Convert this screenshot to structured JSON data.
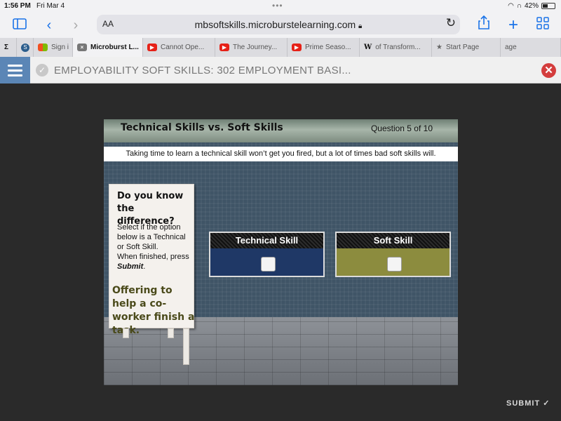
{
  "status_bar": {
    "time": "1:56 PM",
    "date": "Fri Mar 4",
    "battery": "42%",
    "battery_level": 0.42
  },
  "toolbar": {
    "text_size_label": "AA",
    "url": "mbsoftskills.microburstelearning.com",
    "icons": [
      "sidebar-icon",
      "back-icon",
      "forward-icon",
      "lock-icon",
      "reload-icon",
      "share-icon",
      "plus-icon",
      "tabs-grid-icon"
    ]
  },
  "tabs": [
    {
      "label": "",
      "favicon": "sigma"
    },
    {
      "label": "",
      "favicon": "s"
    },
    {
      "label": "Sign i",
      "favicon": "ms"
    },
    {
      "label": "Microburst L...",
      "favicon": "x",
      "active": true
    },
    {
      "label": "Cannot Ope...",
      "favicon": "yt"
    },
    {
      "label": "The Journey...",
      "favicon": "yt"
    },
    {
      "label": "Prime Seaso...",
      "favicon": "yt"
    },
    {
      "label": "of Transform...",
      "favicon": "w"
    },
    {
      "label": "Start Page",
      "favicon": "star"
    },
    {
      "label": "age",
      "favicon": ""
    }
  ],
  "app_header": {
    "title": "EMPLOYABILITY SOFT SKILLS: 302 EMPLOYMENT BASI..."
  },
  "stage": {
    "title": "Technical Skills vs. Soft Skills",
    "question_count": "Question 5 of 10",
    "subtitle": "Taking time to learn a technical skill won’t get you fired, but a lot of times bad soft skills will.",
    "sign": {
      "question": "Do you know the difference?",
      "instructions": "Select if the option below is a Technical or Soft Skill.",
      "instructions_2": "When finished, press",
      "instructions_submit": "Submit",
      "prompt": "Offering to help a co-worker finish a task."
    },
    "options": {
      "technical": "Technical Skill",
      "soft": "Soft Skill"
    },
    "colors": {
      "technical": "#1f3866",
      "soft": "#8c8c3e"
    }
  },
  "footer": {
    "submit_label": "SUBMIT"
  }
}
